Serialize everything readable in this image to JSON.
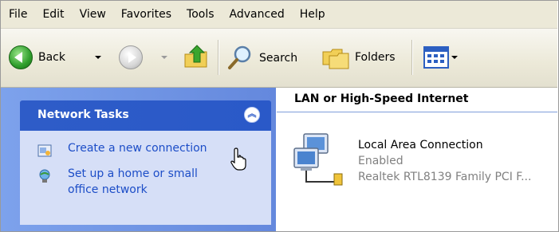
{
  "menu": [
    "File",
    "Edit",
    "View",
    "Favorites",
    "Tools",
    "Advanced",
    "Help"
  ],
  "toolbar": {
    "back_label": "Back",
    "search_label": "Search",
    "folders_label": "Folders"
  },
  "task_pane": {
    "title": "Network Tasks",
    "tasks": [
      {
        "label": "Create a new connection"
      },
      {
        "label_line1": "Set up a home or small",
        "label_line2": "office network"
      }
    ]
  },
  "content": {
    "group_header": "LAN or High-Speed Internet",
    "item": {
      "name": "Local Area Connection",
      "status": "Enabled",
      "device": "Realtek RTL8139 Family PCI F..."
    }
  },
  "colors": {
    "task_header": "#2e5cc8",
    "task_link": "#1c4dc7",
    "pane_background": "#6d8fe0"
  }
}
